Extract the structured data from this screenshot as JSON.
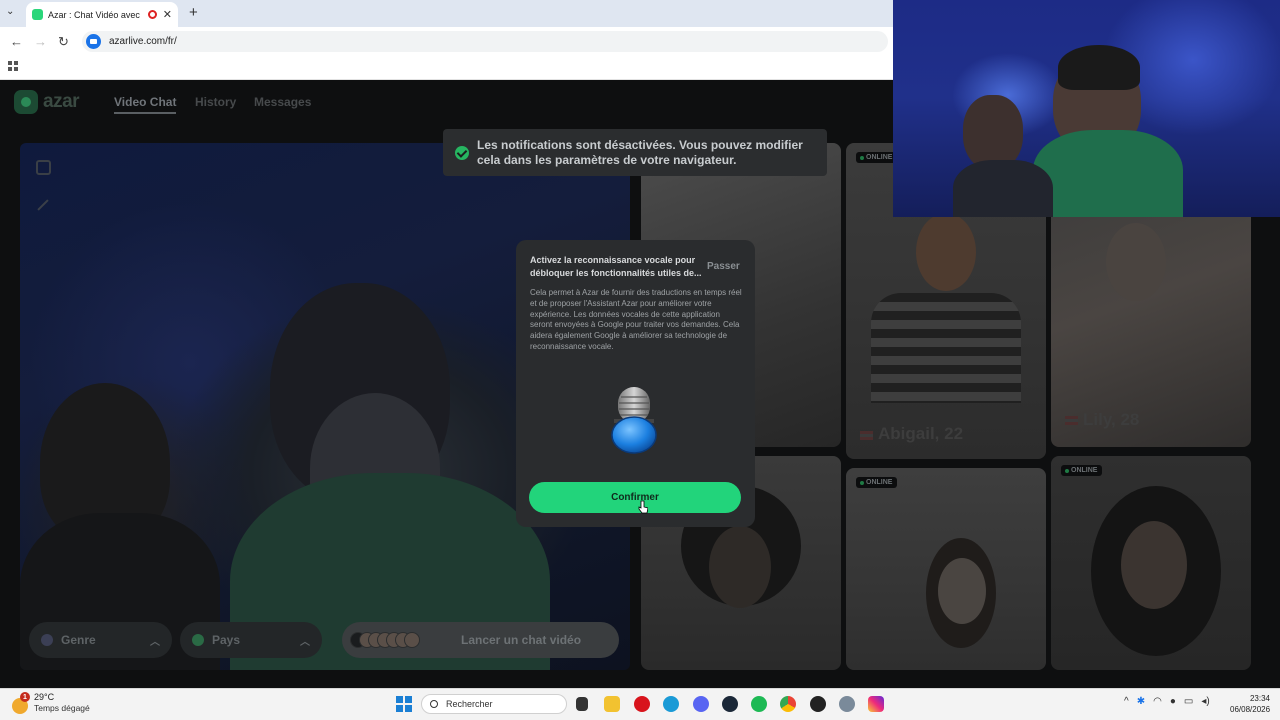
{
  "browser": {
    "tab_title": "Azar : Chat Vidéo avec de n",
    "url": "azarlive.com/fr/"
  },
  "azar": {
    "logo_text": "azar",
    "nav": {
      "video_chat": "Video Chat",
      "history": "History",
      "messages": "Messages"
    },
    "notification": "Les notifications sont désactivées. Vous pouvez modifier cela dans les paramètres de votre navigateur.",
    "controls": {
      "genre": "Genre",
      "pays": "Pays",
      "start_chat": "Lancer un chat vidéo"
    },
    "profiles": [
      {
        "name": "Abigail, 22",
        "online": "ONLINE"
      },
      {
        "name": "Lily, 28"
      },
      {
        "online": "ONLINE"
      },
      {
        "online": "ONLINE"
      }
    ],
    "modal": {
      "title": "Activez la reconnaissance vocale pour débloquer les fonctionnalités utiles de...",
      "skip": "Passer",
      "body": "Cela permet à Azar de fournir des traductions en temps réel et de proposer l'Assistant Azar pour améliorer votre expérience. Les données vocales de cette application seront envoyées à Google pour traiter vos demandes. Cela aidera également Google à améliorer sa technologie de reconnaissance vocale.",
      "confirm": "Confirmer"
    }
  },
  "taskbar": {
    "temperature": "29°C",
    "weather": "Temps dégagé",
    "weather_badge": "1",
    "search": "Rechercher",
    "time": "23:34",
    "date": "06/08/2026"
  },
  "colors": {
    "accent_green": "#22d47b",
    "page_bg": "#0e0f10",
    "modal_bg": "#2a2c2e"
  }
}
